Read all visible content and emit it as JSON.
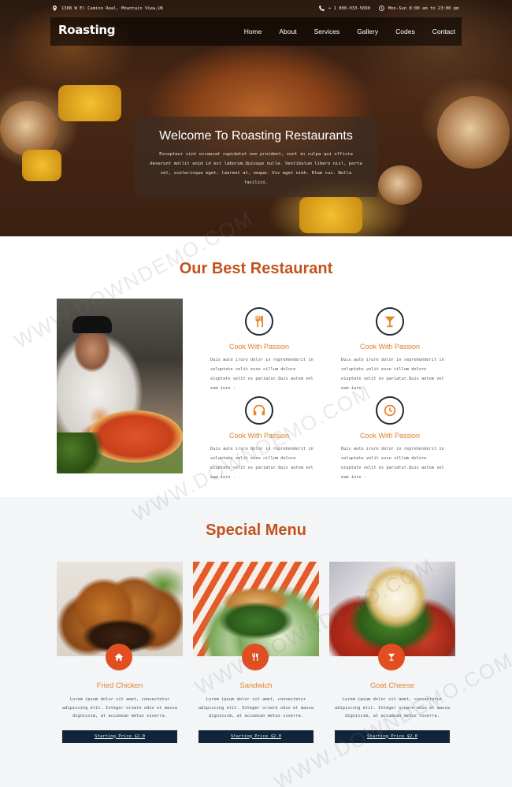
{
  "topbar": {
    "address": "1388 W El Camino Real, Mountain View,UK",
    "phone": "+ 1 800-033-5090",
    "hours": "Mon-Sun 8:00 am to 23:00 pm"
  },
  "brand": {
    "logo": "Roasting"
  },
  "nav": {
    "items": [
      "Home",
      "About",
      "Services",
      "Gallery",
      "Codes",
      "Contact"
    ]
  },
  "hero": {
    "title": "Welcome To Roasting Restaurants",
    "text": "Excepteur sint occaecat cupidatat non proident, sunt in culpa qui officia deserunt mollit anim id est laborum.Quisque nulla. Vestibulum libero nisl, porta vel, scelerisque eget, laoreet at, neque. Viv eget nibh. Etam cus. Nulla facilisi."
  },
  "best": {
    "title": "Our Best Restaurant",
    "features": [
      {
        "icon": "cutlery-icon",
        "title": "Cook With Passion",
        "text": "Duis aute irure dolor in reprehenderit in voluptate velit esse cillum dolore eiuptate velit es pariatur.Quis autem vel eum iure ."
      },
      {
        "icon": "cocktail-icon",
        "title": "Cook With Passion",
        "text": "Duis aute irure dolor in reprehenderit in voluptate velit esse cillum dolore eiuptate velit es pariatur.Quis autem vel eum iure ."
      },
      {
        "icon": "headphones-icon",
        "title": "Cook With Passion",
        "text": "Duis aute irure dolor in reprehenderit in voluptate velit esse cillum dolore eiuptate velit es pariatur.Quis autem vel eum iure ."
      },
      {
        "icon": "clock-icon",
        "title": "Cook With Passion",
        "text": "Duis aute irure dolor in reprehenderit in voluptate velit esse cillum dolore eiuptate velit es pariatur.Quis autem vel eum iure ."
      }
    ]
  },
  "menu": {
    "title": "Special Menu",
    "items": [
      {
        "icon": "home-icon",
        "name": "Fried Chicken",
        "text": "Lorem ipsum dolor sit amet, consectetur adipiscing elit. Integer ornare odio et massa dignissim, at accumsan metus viverra.",
        "button": "Starting Price $2.0"
      },
      {
        "icon": "cutlery-icon",
        "name": "Sandwich",
        "text": "Lorem ipsum dolor sit amet, consectetur adipiscing elit. Integer ornare odio et massa dignissim, at accumsan metus viverra.",
        "button": "Starting Price $2.0"
      },
      {
        "icon": "cocktail-icon",
        "name": "Goat Cheese",
        "text": "Lorem ipsum dolor sit amet, consectetur adipiscing elit. Integer ornare odio et massa dignissim, at accumsan metus viverra.",
        "button": "Starting Price $2.0"
      }
    ]
  },
  "watermark": {
    "text": "WWW.DOWNDEMO.COM"
  },
  "colors": {
    "accent": "#c2531d",
    "orange": "#e6862d",
    "badge": "#e24e1f",
    "navy": "#10253a"
  }
}
